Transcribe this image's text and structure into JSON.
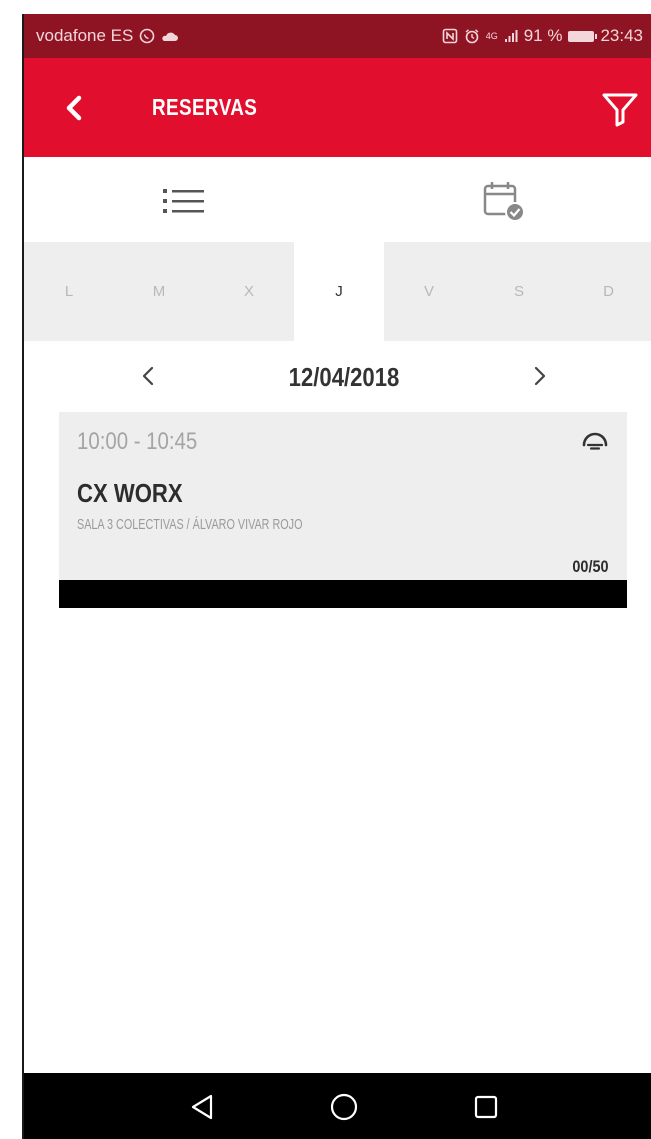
{
  "status_bar": {
    "carrier": "vodafone ES",
    "signal": "4G",
    "battery": "91 %",
    "time": "23:43"
  },
  "header": {
    "title": "RESERVAS",
    "back_icon": "chevron-left-icon",
    "filter_icon": "filter-icon"
  },
  "view_toggle": {
    "list_icon": "list-icon",
    "calendar_icon": "calendar-check-icon"
  },
  "weekdays": {
    "active_index": 3,
    "items": [
      "L",
      "M",
      "X",
      "J",
      "V",
      "S",
      "D"
    ]
  },
  "date_nav": {
    "date": "12/04/2018",
    "prev_icon": "chevron-left-icon",
    "next_icon": "chevron-right-icon"
  },
  "class_card": {
    "time": "10:00 - 10:45",
    "title": "CX WORX",
    "subtitle": "SALA 3 COLECTIVAS / ÁLVARO VIVAR ROJO",
    "capacity": "00/50",
    "occupancy_fraction": 0,
    "icon": "gauge-icon"
  },
  "nav_bar": {
    "back_icon": "triangle-back-icon",
    "home_icon": "circle-home-icon",
    "recents_icon": "square-recents-icon"
  },
  "colors": {
    "brand_red": "#e20e2e",
    "status_bar": "#8f1423",
    "card_bg": "#eeeeee",
    "text_dark": "#2d2d2d"
  }
}
